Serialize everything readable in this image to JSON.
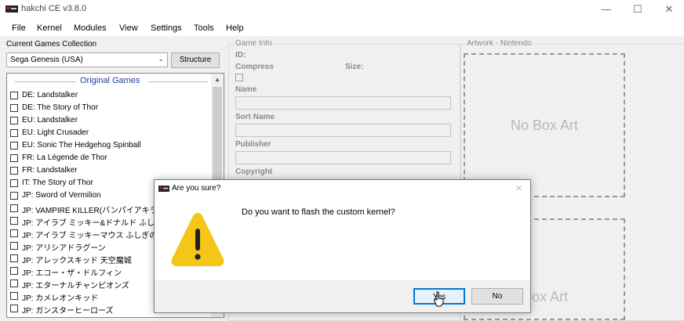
{
  "window": {
    "title": "hakchi CE v3.8.0",
    "minimize": "—",
    "maximize": "☐",
    "close": "✕"
  },
  "menu": [
    "File",
    "Kernel",
    "Modules",
    "View",
    "Settings",
    "Tools",
    "Help"
  ],
  "collection": {
    "label": "Current Games Collection",
    "selected": "Sega Genesis (USA)",
    "structure_button": "Structure"
  },
  "games": {
    "group_title": "Original Games",
    "items": [
      "DE: Landstalker",
      "DE: The Story of Thor",
      "EU: Landstalker",
      "EU: Light Crusader",
      "EU: Sonic The Hedgehog Spinball",
      "FR: La Légende de Thor",
      "FR: Landstalker",
      "IT: The Story of Thor",
      "JP: Sword of Vermilion",
      "JP: VAMPIRE KILLER(バンパイアキラー",
      "JP: アイラブ ミッキー&ドナルド ふしぎな",
      "JP: アイラブ ミッキーマウス ふしぎのお城大",
      "JP: アリシアドラグーン",
      "JP: アレックスキッド 天空魔城",
      "JP: エコー・ザ・ドルフィン",
      "JP: エターナルチャンピオンズ",
      "JP: カメレオンキッド",
      "JP: ガンスターヒーローズ"
    ]
  },
  "game_info": {
    "title": "Game Info",
    "id_label": "ID:",
    "compress_label": "Compress",
    "size_label": "Size:",
    "name_label": "Name",
    "sort_name_label": "Sort Name",
    "publisher_label": "Publisher",
    "copyright_label": "Copyright"
  },
  "artwork": {
    "title": "Artwork - Nintendo",
    "no_box_art": "No Box Art",
    "no_box_art_partial": "ox Art"
  },
  "dialog": {
    "title": "Are you sure?",
    "close": "✕",
    "message": "Do you want to flash the custom kernel?",
    "yes": "Yes",
    "no": "No"
  },
  "colors": {
    "warning_yellow": "#f5c518",
    "group_title_blue": "#1f3f9a",
    "focus_blue": "#0078d7"
  }
}
